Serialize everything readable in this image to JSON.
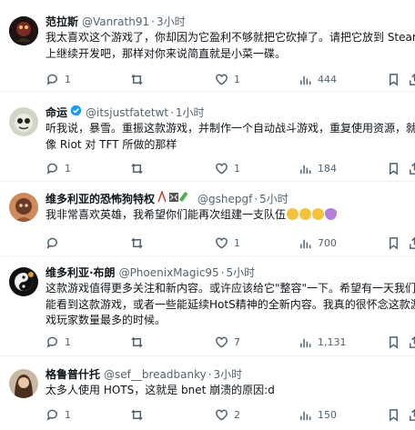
{
  "tweets": [
    {
      "name": "范拉斯",
      "handle": "@Vanrath91",
      "sep": "·",
      "time": "3小时",
      "lines": [
        "我太喜欢这个游戏了，你却因为它盈利不够就把它砍掉了。请把它放到 Steam",
        "上继续开发吧，那样对你来说简直就是小菜一碟。"
      ],
      "replies": "1",
      "retweets": "",
      "likes": "1",
      "views": "444"
    },
    {
      "name": "命运",
      "handle": "@itsjustfatetwt",
      "sep": "·",
      "time": "1小时",
      "lines": [
        "听我说，暴雪。重振这款游戏，并制作一个自动战斗游戏，重复使用资源，就",
        "像 Riot 对 TFT 所做的那样"
      ],
      "replies": "1",
      "retweets": "",
      "likes": "1",
      "views": "184"
    },
    {
      "name": "维多利亚的恐怖狗特权",
      "handle": "@gshepgf",
      "sep": "·",
      "time": "5小时",
      "lines": [
        "我非常喜欢英雄，我希望你们能再次组建一支队伍"
      ],
      "replies": "",
      "retweets": "",
      "likes": "1",
      "views": "700"
    },
    {
      "name": "维多利亚·布朗",
      "handle": "@PhoenixMagic95",
      "sep": "·",
      "time": "5小时",
      "lines": [
        "这款游戏值得更多关注和新内容。或许应该给它\"整容\"一下。希望有一天我们",
        "能看到这款游戏，或者一些能延续HotS精神的全新内容。我真的很怀念这款游",
        "戏玩家数量最多的时候。"
      ],
      "replies": "1",
      "retweets": "",
      "likes": "7",
      "views": "1,131"
    },
    {
      "name": "格鲁普什托",
      "handle": "@sef__breadbanky",
      "sep": "·",
      "time": "3小时",
      "lines": [
        "太多人使用 HOTS，这就是 bnet 崩溃的原因:d"
      ],
      "replies": "1",
      "retweets": "",
      "likes": "2",
      "views": "150"
    }
  ],
  "colors": {
    "text": "#0f1419",
    "secondary": "#536471",
    "verified": "#1d9bf0",
    "divider": "#eff3f4"
  },
  "icons": [
    "reply-icon",
    "retweet-icon",
    "like-icon",
    "views-icon",
    "bookmark-icon",
    "share-icon",
    "verified-badge-icon"
  ]
}
